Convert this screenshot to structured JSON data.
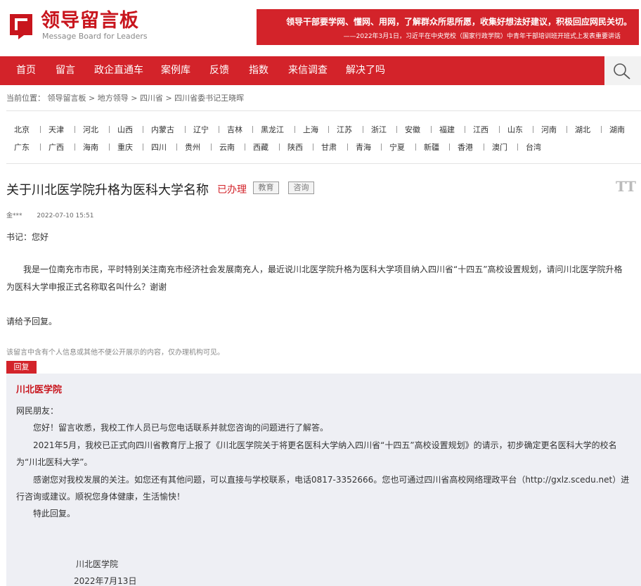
{
  "header": {
    "logo_title": "领导留言板",
    "logo_subtitle": "Message Board for Leaders",
    "banner_line1": "领导干部要学网、懂网、用网，了解群众所思所愿，收集好想法好建议，积极回应网民关切。",
    "banner_line2": "——2022年3月1日，习近平在中央党校（国家行政学院）中青年干部培训班开班式上发表重要讲话"
  },
  "nav": {
    "items": [
      "首页",
      "留言",
      "政企直通车",
      "案例库",
      "反馈",
      "指数",
      "来信调查",
      "解决了吗"
    ]
  },
  "breadcrumb": {
    "prefix": "当前位置：",
    "items": [
      "领导留言板",
      "地方领导",
      "四川省",
      "四川省委书记王晓晖"
    ],
    "separator": ">"
  },
  "regions": {
    "row1": [
      "北京",
      "天津",
      "河北",
      "山西",
      "内蒙古",
      "辽宁",
      "吉林",
      "黑龙江",
      "上海",
      "江苏",
      "浙江",
      "安徽",
      "福建",
      "江西",
      "山东",
      "河南",
      "湖北",
      "湖南"
    ],
    "row2": [
      "广东",
      "广西",
      "海南",
      "重庆",
      "四川",
      "贵州",
      "云南",
      "西藏",
      "陕西",
      "甘肃",
      "青海",
      "宁夏",
      "新疆",
      "香港",
      "澳门",
      "台湾"
    ]
  },
  "post": {
    "title": "关于川北医学院升格为医科大学名称",
    "status": "已办理",
    "tags": [
      "教育",
      "咨询"
    ],
    "font_toggle": "TT",
    "author": "金***",
    "time": "2022-07-10 15:51",
    "greeting": "书记：您好",
    "body_line1": "　　我是一位南充市市民，平时特别关注南充市经济社会发展南充人，最近说川北医学院升格为医科大学项目纳入四川省“十四五”高校设置规划，请问川北医学院升格",
    "body_line2": "为医科大学申报正式名称取名叫什么？谢谢",
    "closing": "请给予回复。",
    "privacy_note": "该留言中含有个人信息或其他不便公开展示的内容，仅办理机构可见。"
  },
  "reply": {
    "tab_label": "回复",
    "org": "川北医学院",
    "salutation": "网民朋友：",
    "para1": "　　您好！留言收悉，我校工作人员已与您电话联系并就您咨询的问题进行了解答。",
    "para2_line1": "　　2021年5月，我校已正式向四川省教育厅上报了《川北医学院关于将更名医科大学纳入四川省“十四五”高校设置规划》的请示，初步确定更名医科大学的校名",
    "para2_line2": "为“川北医科大学”。",
    "para3_line1": "　　感谢您对我校发展的关注。如您还有其他问题，可以直接与学校联系，电话0817-3352666。您也可通过四川省高校网络理政平台（http://gxlz.scedu.net）进",
    "para3_line2": "行咨询或建议。顺祝您身体健康，生活愉快！",
    "para4": "　　特此回复。",
    "sign_org": "川北医学院",
    "sign_date": "2022年7月13日"
  },
  "colors": {
    "brand_red": "#d3232a",
    "reply_bg": "#eeeff4"
  },
  "icons": {
    "search": "search-icon",
    "logo": "logo-mark-icon"
  }
}
